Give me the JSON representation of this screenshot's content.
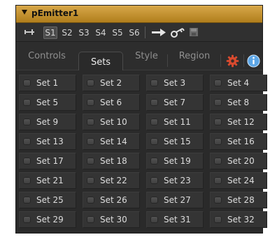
{
  "colors": {
    "title_bar": "#c9962f",
    "panel_background": "#2a2a2a",
    "text": "#dddddd",
    "muted_text": "#8f8f8f",
    "settings_icon": "#d84a2f",
    "info_icon": "#5da6e6"
  },
  "header": {
    "title": "pEmitter1",
    "icon": "collapse-triangle-icon"
  },
  "toolbar": {
    "pin_icon": "pin-icon",
    "set_tabs": [
      "S1",
      "S2",
      "S3",
      "S4",
      "S5",
      "S6"
    ],
    "active_set_tab": "S1",
    "arrow_icon": "arrow-right-icon",
    "key_icon": "key-icon",
    "save_icon": "save-icon"
  },
  "tabs": {
    "items": [
      "Controls",
      "Sets",
      "Style",
      "Region"
    ],
    "active": "Sets",
    "settings_icon": "gear-icon",
    "info_icon": "info-icon"
  },
  "sets": [
    "Set 1",
    "Set 2",
    "Set 3",
    "Set 4",
    "Set 5",
    "Set 6",
    "Set 7",
    "Set 8",
    "Set 9",
    "Set 10",
    "Set 11",
    "Set 12",
    "Set 13",
    "Set 14",
    "Set 15",
    "Set 16",
    "Set 17",
    "Set 18",
    "Set 19",
    "Set 20",
    "Set 21",
    "Set 22",
    "Set 23",
    "Set 24",
    "Set 25",
    "Set 26",
    "Set 27",
    "Set 28",
    "Set 29",
    "Set 30",
    "Set 31",
    "Set 32"
  ]
}
